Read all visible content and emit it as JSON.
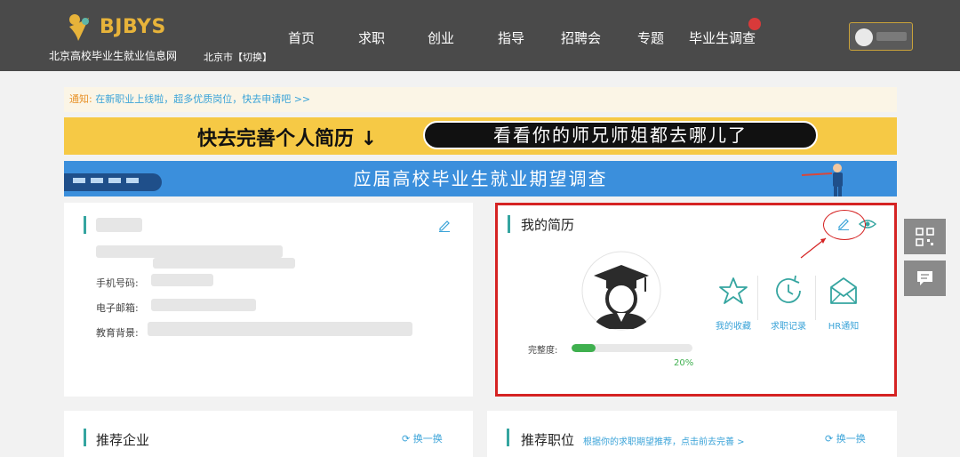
{
  "header": {
    "logo_text": "BJBYS",
    "site_name": "北京高校毕业生就业信息网",
    "city": "北京市【切换】",
    "nav": [
      "首页",
      "求职",
      "创业",
      "指导",
      "招聘会",
      "专题",
      "毕业生调查"
    ]
  },
  "notice": {
    "label": "通知:",
    "text": "在新职业上线啦，超多优质岗位，快去申请吧 >>"
  },
  "banner_resume": {
    "left_text": "快去完善个人简历 ↓",
    "pill_text": "看看你的师兄师姐都去哪儿了"
  },
  "banner_survey": {
    "text": "应届高校毕业生就业期望调查"
  },
  "profile_card": {
    "phone_label": "手机号码:",
    "email_label": "电子邮箱:",
    "education_label": "教育背景:"
  },
  "resume_card": {
    "title": "我的简历",
    "tiles": [
      {
        "label": "我的收藏",
        "icon": "star-icon"
      },
      {
        "label": "求职记录",
        "icon": "history-icon"
      },
      {
        "label": "HR通知",
        "icon": "mail-icon"
      }
    ],
    "completeness_label": "完整度:",
    "completeness_value": 20,
    "completeness_text": "20%"
  },
  "recommend_companies": {
    "title": "推荐企业",
    "refresh": "换一换"
  },
  "recommend_jobs": {
    "title": "推荐职位",
    "hint": "根据你的求职期望推荐，点击前去完善 >",
    "refresh": "换一换"
  },
  "colors": {
    "header_bg": "#4a4a4a",
    "accent_teal": "#35a5a0",
    "link_blue": "#3aa3d8",
    "progress_green": "#3fb04f",
    "highlight_red": "#d52323"
  }
}
